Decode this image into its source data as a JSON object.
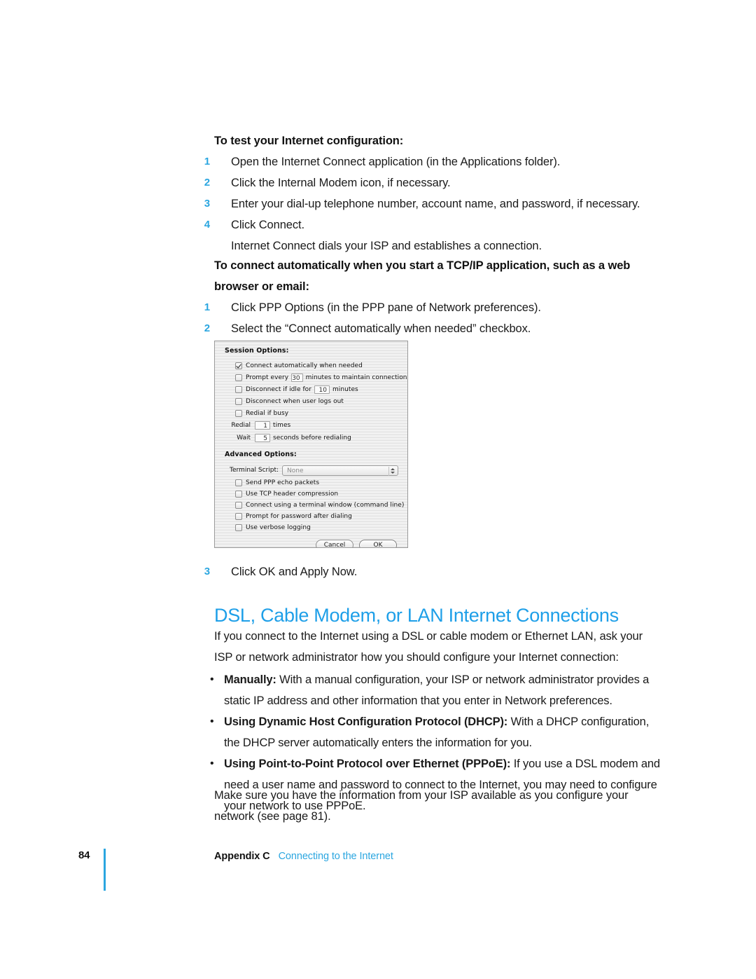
{
  "sections": {
    "test_config": {
      "heading": "To test your Internet configuration:",
      "steps": [
        {
          "num": "1",
          "text": "Open the Internet Connect application (in the Applications folder)."
        },
        {
          "num": "2",
          "text": "Click the Internal Modem icon, if necessary."
        },
        {
          "num": "3",
          "text": "Enter your dial-up telephone number, account name, and password, if necessary."
        },
        {
          "num": "4",
          "text": "Click Connect."
        }
      ],
      "followup": "Internet Connect dials your ISP and establishes a connection."
    },
    "auto_connect": {
      "heading": "To connect automatically when you start a TCP/IP application, such as a web browser or email:",
      "steps": [
        {
          "num": "1",
          "text": "Click PPP Options (in the PPP pane of Network preferences)."
        },
        {
          "num": "2",
          "text": "Select the “Connect automatically when needed” checkbox."
        }
      ],
      "final_step": {
        "num": "3",
        "text": "Click OK and Apply Now."
      }
    },
    "dsl": {
      "heading": "DSL, Cable Modem, or LAN Internet Connections",
      "intro_line1": "If you connect to the Internet using a DSL or cable modem or Ethernet LAN, ask your",
      "intro_line2": "ISP or network administrator how you should configure your Internet connection:",
      "bullets": [
        {
          "lead": "Manually:",
          "rest": " With a manual configuration, your ISP or network administrator provides a static IP address and other information that you enter in Network preferences."
        },
        {
          "lead": "Using Dynamic Host Configuration Protocol (DHCP):",
          "rest": " With a DHCP configuration, the DHCP server automatically enters the information for you."
        },
        {
          "lead": "Using Point-to-Point Protocol over Ethernet (PPPoE):",
          "rest": " If you use a DSL modem and need a user name and password to connect to the Internet, you may need to configure your network to use PPPoE."
        }
      ],
      "closing_line1": "Make sure you have the information from your ISP available as you configure your",
      "closing_line2": "network (see page 81)."
    }
  },
  "dialog": {
    "session_title": "Session Options:",
    "session_rows": [
      {
        "checked": true,
        "label": "Connect automatically when needed"
      },
      {
        "checked": false,
        "label_before": "Prompt every",
        "value": "30",
        "label_after": "minutes to maintain connection"
      },
      {
        "checked": false,
        "label_before": "Disconnect if idle for",
        "value": "10",
        "label_after": "minutes"
      },
      {
        "checked": false,
        "label": "Disconnect when user logs out"
      },
      {
        "checked": false,
        "label": "Redial if busy"
      }
    ],
    "redial_caption": "Redial",
    "redial_value": "1",
    "redial_suffix": "times",
    "wait_caption": "Wait",
    "wait_value": "5",
    "wait_suffix": "seconds before redialing",
    "advanced_title": "Advanced Options:",
    "terminal_label": "Terminal Script:",
    "terminal_value": "None",
    "advanced_rows": [
      {
        "checked": false,
        "label": "Send PPP echo packets"
      },
      {
        "checked": false,
        "label": "Use TCP header compression"
      },
      {
        "checked": false,
        "label": "Connect using a terminal window (command line)"
      },
      {
        "checked": false,
        "label": "Prompt for password after dialing"
      },
      {
        "checked": false,
        "label": "Use verbose logging"
      }
    ],
    "cancel_label": "Cancel",
    "ok_label": "OK"
  },
  "footer": {
    "page_number": "84",
    "appendix": "Appendix C",
    "chapter": "Connecting to the Internet"
  },
  "colors": {
    "accent_blue": "#2ba6e0",
    "heading_blue": "#1e9fe8",
    "body_text": "#1a1a1a"
  }
}
